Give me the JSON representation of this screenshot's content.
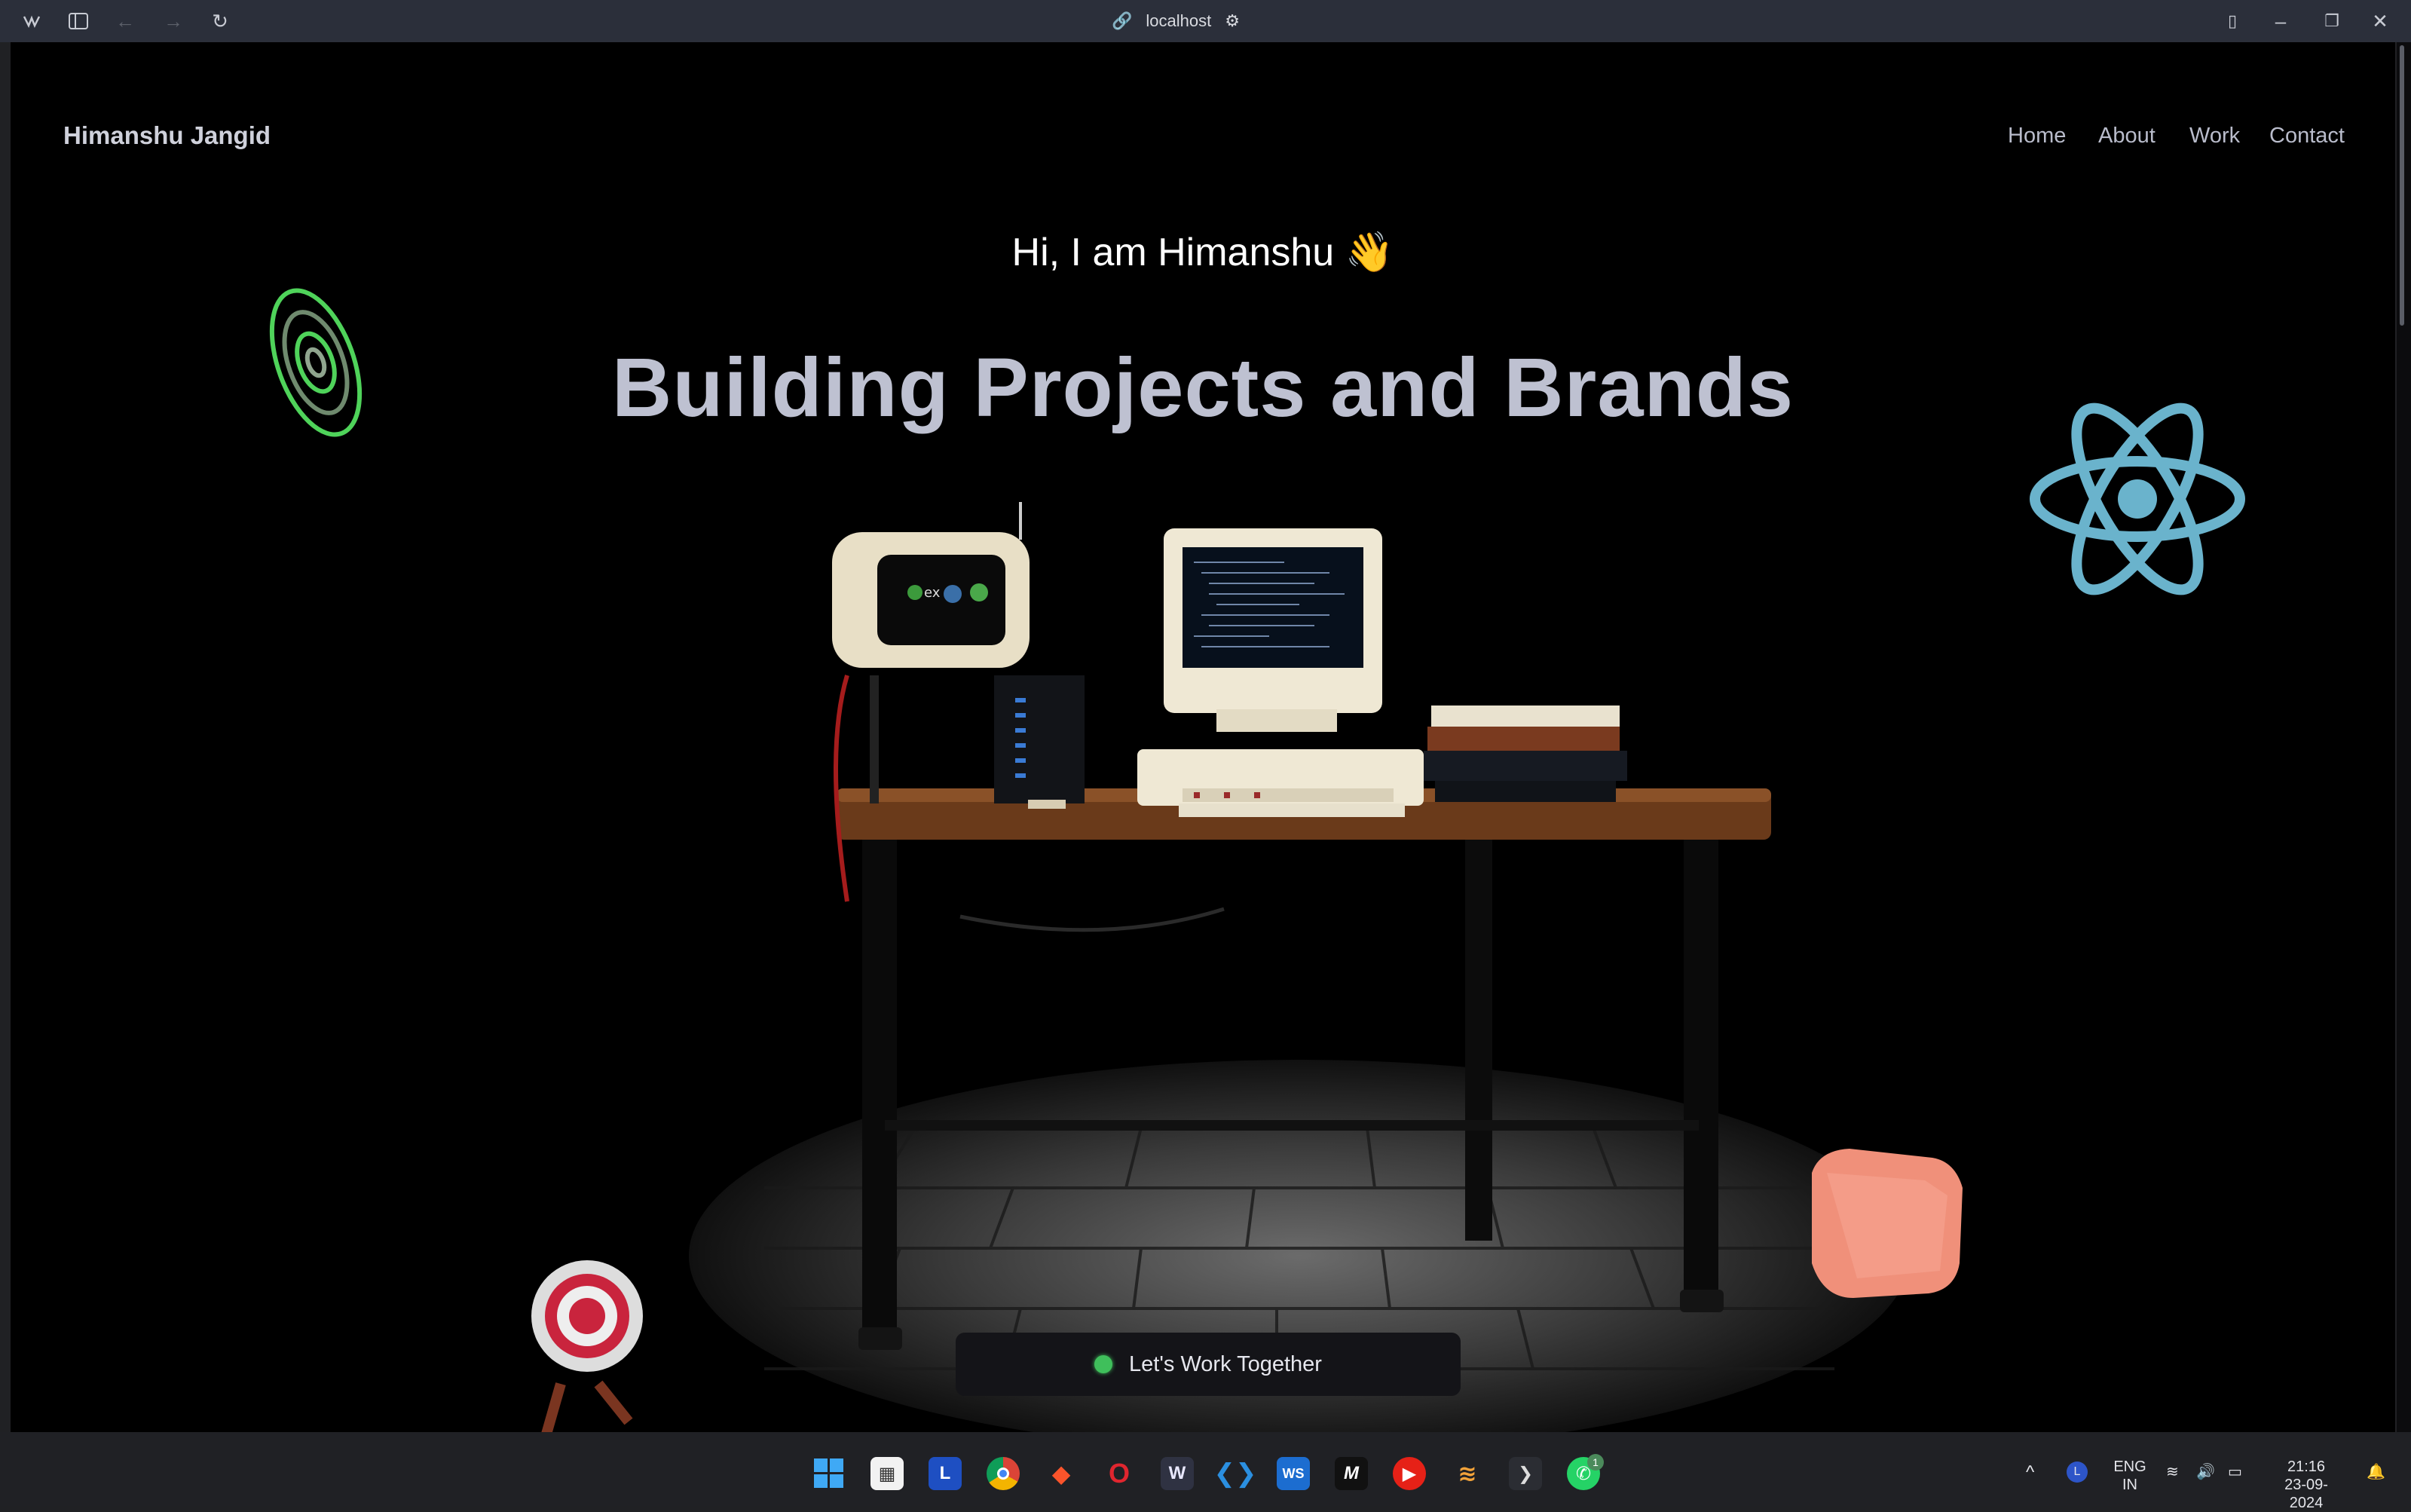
{
  "browser": {
    "url": "localhost",
    "icons": [
      "browser-logo-icon",
      "sidebar-toggle-icon",
      "back-icon",
      "forward-icon",
      "reload-icon",
      "link-icon",
      "site-settings-icon",
      "split-view-icon",
      "minimize-icon",
      "restore-icon",
      "close-icon"
    ]
  },
  "site": {
    "brand": "Himanshu Jangid",
    "nav": [
      "Home",
      "About",
      "Work",
      "Contact"
    ],
    "greeting": "Hi, I am Himanshu",
    "greeting_emoji": "👋",
    "headline": "Building Projects and Brands",
    "cta_label": "Let's Work Together",
    "colors": {
      "background": "#000000",
      "headline": "#bec1d1",
      "accent_green": "#3fbf5b",
      "react_blue": "#6ab3cc",
      "cube": "#f0907a"
    },
    "screen_badges": [
      "ex"
    ]
  },
  "taskbar": {
    "apps": [
      "windows-start-icon",
      "microsoft-store-icon",
      "l-app-icon",
      "chrome-icon",
      "brave-icon",
      "opera-icon",
      "browser-active-icon",
      "vscode-icon",
      "webstorm-icon",
      "m-app-icon",
      "youtube-icon",
      "stack-app-icon",
      "terminal-icon",
      "whatsapp-icon"
    ],
    "l_app_label": "L",
    "ws_label": "WS",
    "m_label": "M",
    "whatsapp_badge": "1",
    "lang_top": "ENG",
    "lang_bottom": "IN",
    "time": "21:16",
    "date": "23-09-2024"
  }
}
